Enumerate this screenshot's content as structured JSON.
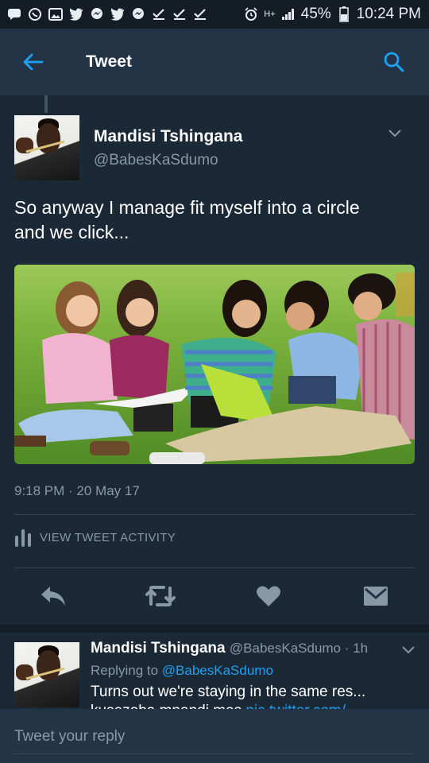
{
  "status_bar": {
    "battery": "45%",
    "time": "10:24 PM",
    "network": "H+",
    "icons": [
      "message-icon",
      "whatsapp-icon",
      "gallery-icon",
      "twitter-icon",
      "messenger-icon",
      "twitter-icon",
      "messenger-icon",
      "check-icon",
      "check-icon",
      "check-icon",
      "alarm-icon",
      "signal-icon",
      "battery-icon"
    ]
  },
  "app_bar": {
    "title": "Tweet"
  },
  "tweet": {
    "author_name": "Mandisi  Tshingana",
    "author_handle": "@BabesKaSdumo",
    "text_line1": "So anyway I manage fit myself into a circle",
    "text_line2": "and we click...",
    "timestamp": "9:18 PM · 20 May 17",
    "activity_label": "VIEW TWEET ACTIVITY"
  },
  "actions": [
    "reply-icon",
    "retweet-icon",
    "like-icon",
    "dm-icon"
  ],
  "reply": {
    "author_name": "Mandisi  Tshingana",
    "author_handle": "@BabesKaSdumo · 1h",
    "replying_prefix": "Replying to ",
    "replying_to": "@BabesKaSdumo",
    "text": "Turns out we're staying in the same res...",
    "text2": "kusezoba mnandi mos ",
    "link": "pic.twitter.com/"
  },
  "compose": {
    "placeholder": "Tweet your reply"
  },
  "colors": {
    "background": "#1b2836",
    "appbar": "#243447",
    "accent": "#1da1f2",
    "muted": "#8899a6"
  }
}
